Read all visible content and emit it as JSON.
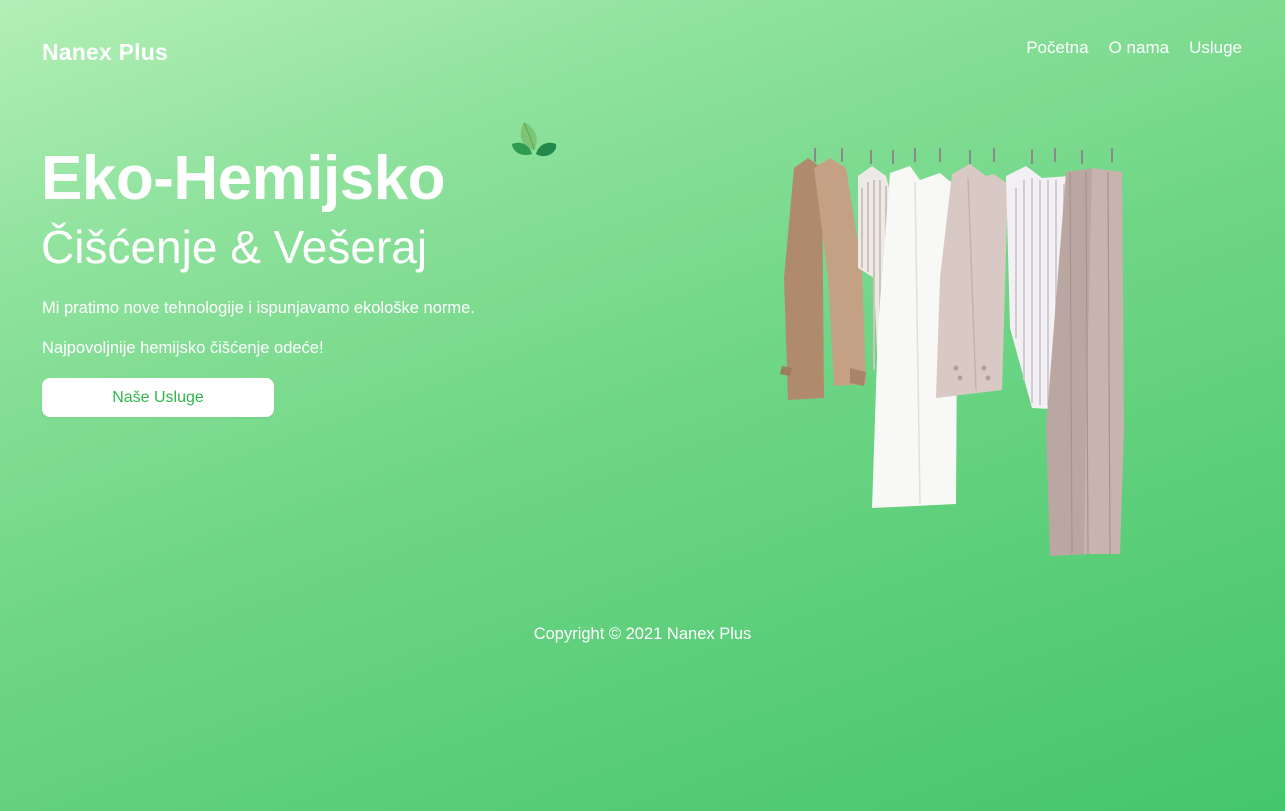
{
  "brand": "Nanex Plus",
  "nav": {
    "home": "Početna",
    "about": "O nama",
    "services": "Usluge"
  },
  "hero": {
    "title": "Eko-Hemijsko",
    "subtitle": "Čišćenje & Vešeraj",
    "line1": "Mi pratimo nove tehnologije i ispunjavamo ekološke norme.",
    "line2": "Najpovoljnije hemijsko čišćenje odeće!",
    "cta_label": "Naše Usluge"
  },
  "footer": {
    "copyright": "Copyright © 2021 Nanex Plus"
  },
  "icons": {
    "title_decoration": "leaf-icon",
    "illustration": "clothes-rack-illustration"
  },
  "colors": {
    "background_start": "#b3efb6",
    "background_end": "#45c66c",
    "button_text": "#2fb84a",
    "text": "#ffffff"
  }
}
